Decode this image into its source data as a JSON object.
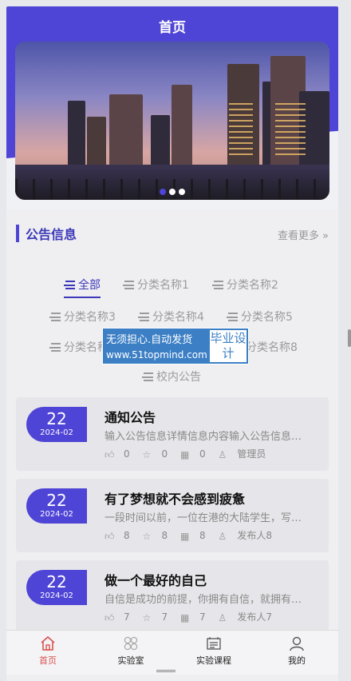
{
  "header": {
    "title": "首页"
  },
  "banner": {
    "slide_count": 3,
    "active_index": 0
  },
  "section": {
    "title": "公告信息",
    "more_label": "查看更多",
    "more_icon": "double-chevron-right-icon"
  },
  "tabs": [
    {
      "label": "全部",
      "active": true
    },
    {
      "label": "分类名称1",
      "active": false
    },
    {
      "label": "分类名称2",
      "active": false
    },
    {
      "label": "分类名称3",
      "active": false
    },
    {
      "label": "分类名称4",
      "active": false
    },
    {
      "label": "分类名称5",
      "active": false
    },
    {
      "label": "分类名称6",
      "active": false
    },
    {
      "label": "分类名称8",
      "active": false
    },
    {
      "label": "校内公告",
      "active": false
    }
  ],
  "watermark": {
    "line1": "无须担心.自动发货",
    "line2": "www.51topmind.com",
    "side": "毕业设计"
  },
  "items": [
    {
      "day": "22",
      "ym": "2024-02",
      "title": "通知公告",
      "desc": "输入公告信息详情信息内容输入公告信息详情信息内容",
      "likes": "0",
      "favs": "0",
      "views": "0",
      "author": "管理员"
    },
    {
      "day": "22",
      "ym": "2024-02",
      "title": "有了梦想就不会感到疲惫",
      "desc": "一段时间以前，一位在港的大陆学生，写了一篇文章",
      "likes": "8",
      "favs": "8",
      "views": "8",
      "author": "发布人8"
    },
    {
      "day": "22",
      "ym": "2024-02",
      "title": "做一个最好的自己",
      "desc": "自信是成功的前提，你拥有自信，就拥有了成功的一半",
      "likes": "7",
      "favs": "7",
      "views": "7",
      "author": "发布人7"
    }
  ],
  "tabbar": [
    {
      "label": "首页",
      "icon": "home-icon",
      "active": true
    },
    {
      "label": "实验室",
      "icon": "grid-circles-icon",
      "active": false
    },
    {
      "label": "实验课程",
      "icon": "board-icon",
      "active": false
    },
    {
      "label": "我的",
      "icon": "user-icon",
      "active": false
    }
  ],
  "colors": {
    "accent": "#4e44d6",
    "active_tab": "#d9534f"
  }
}
